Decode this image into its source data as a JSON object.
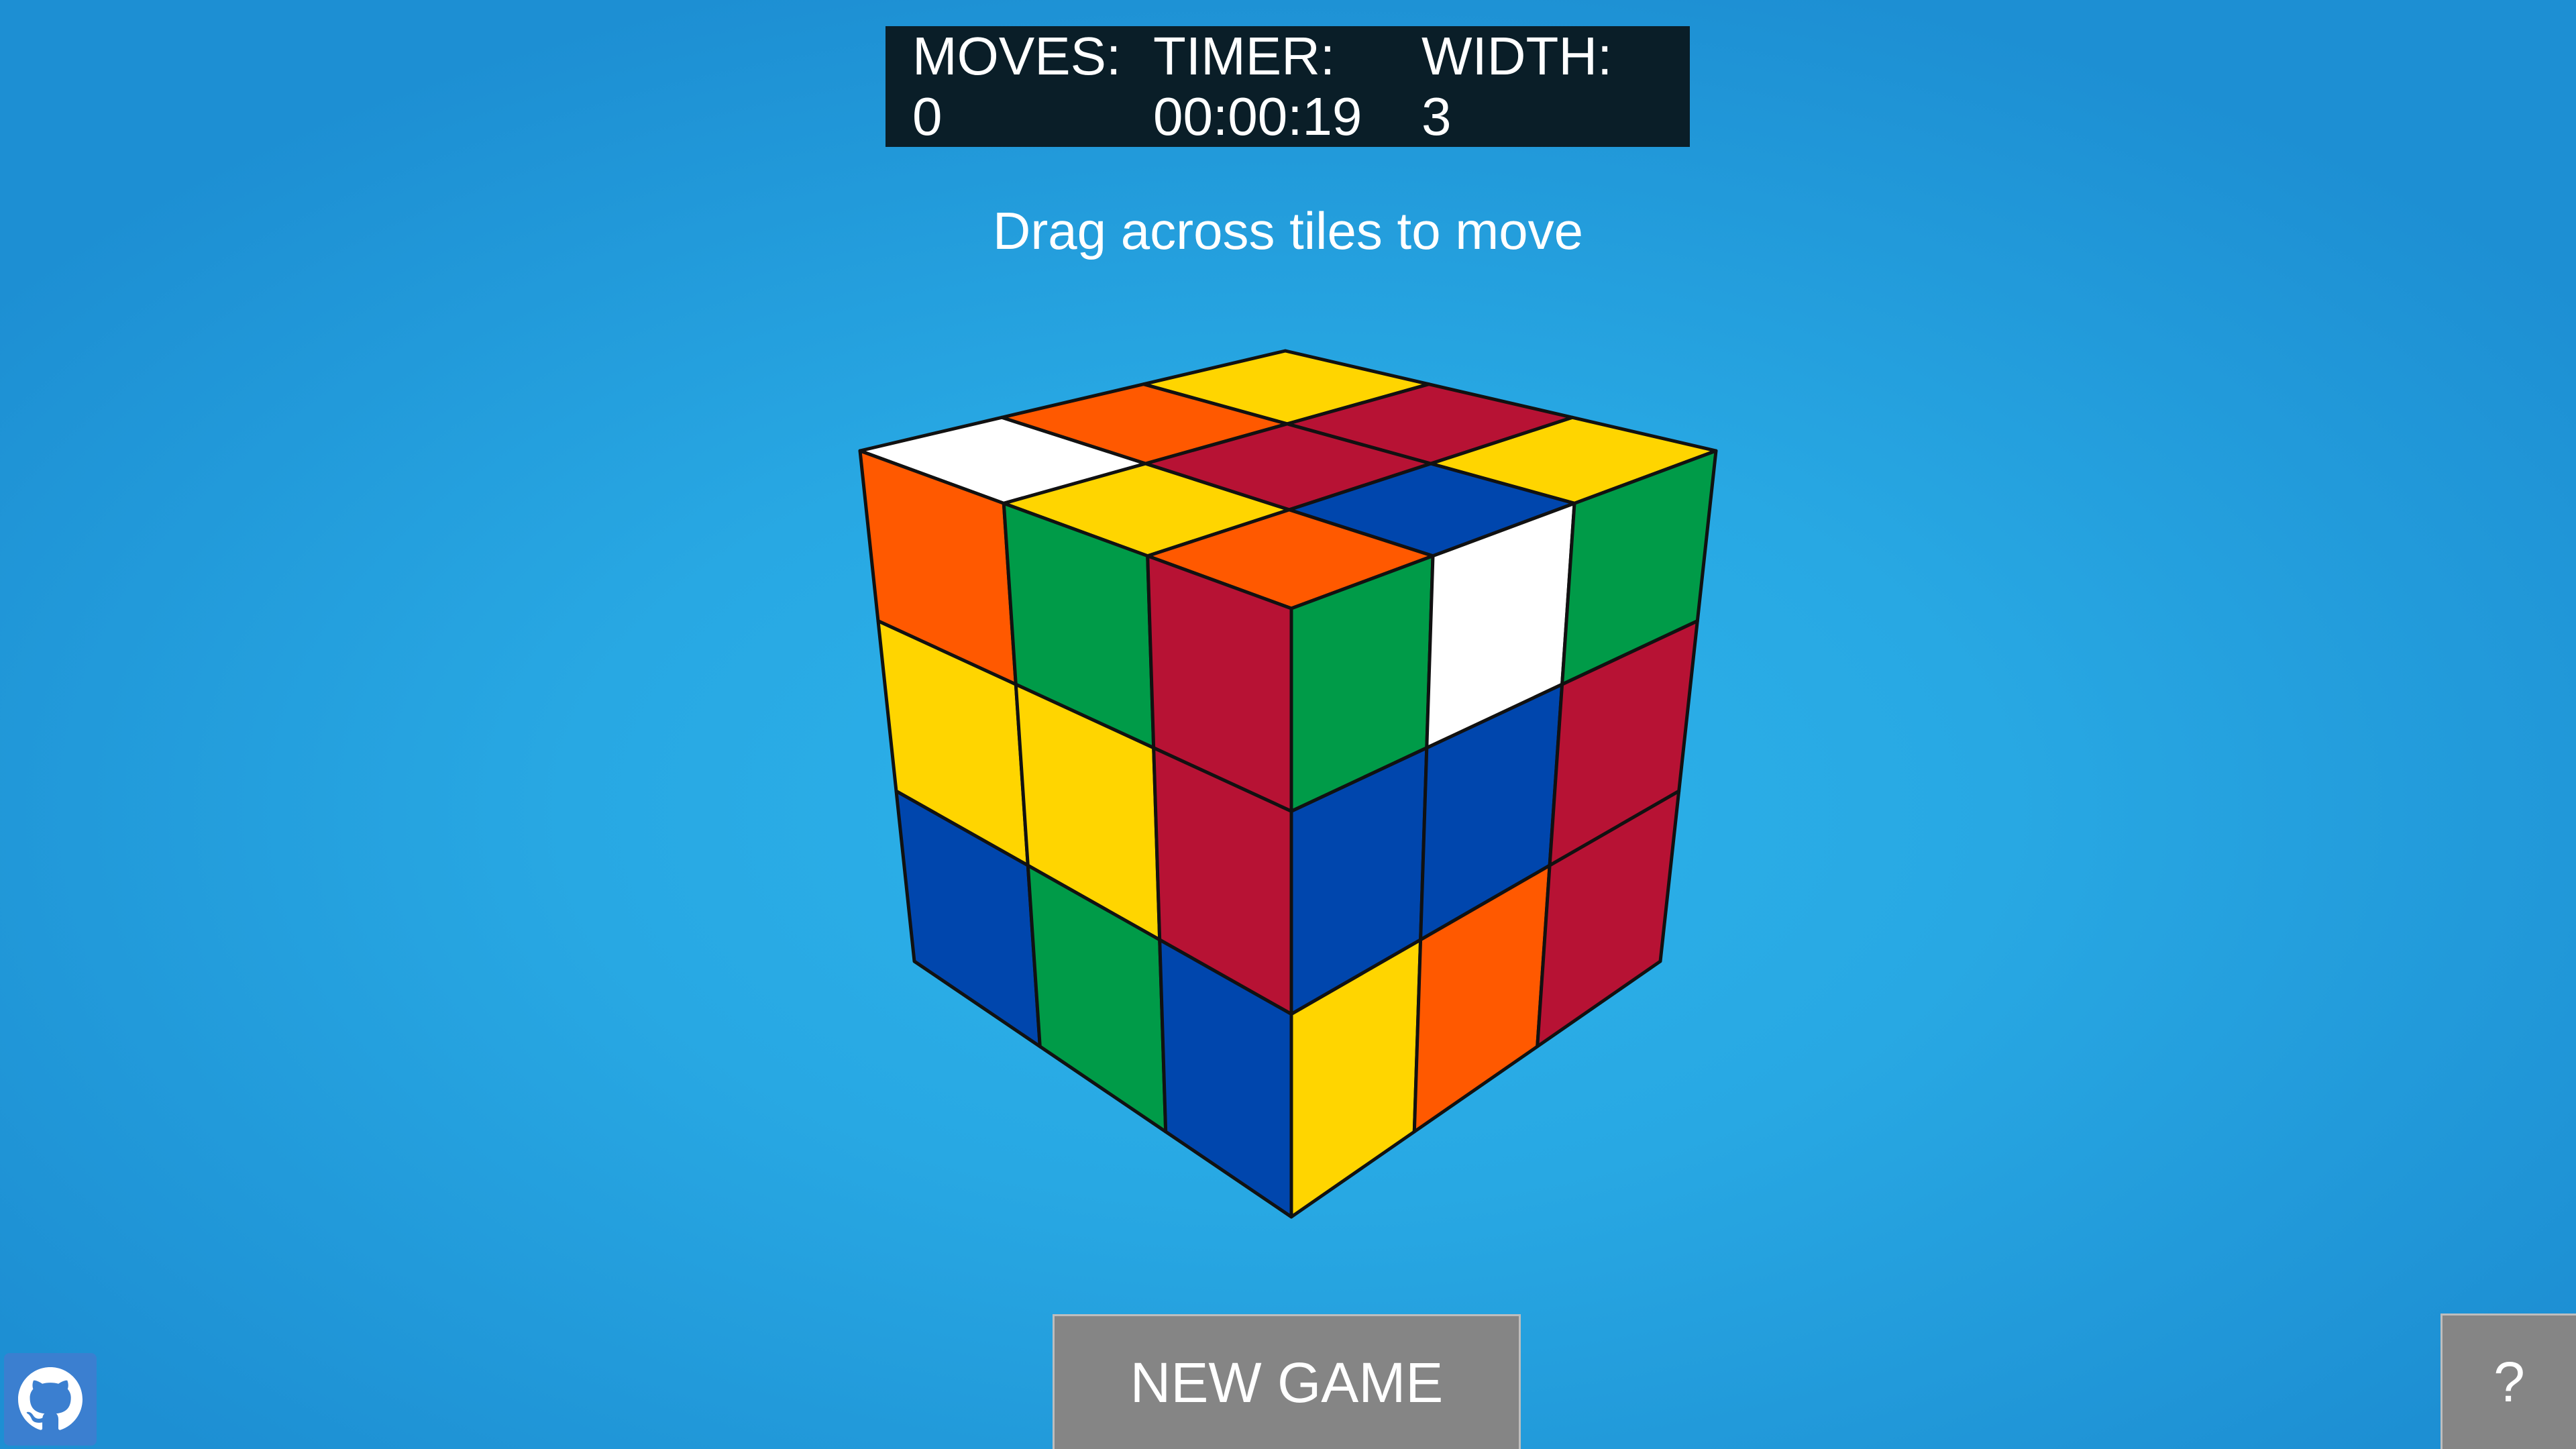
{
  "hud": {
    "moves_label": "MOVES:",
    "moves_value": "0",
    "timer_label": "TIMER:",
    "timer_value": "00:00:19",
    "width_label": "WIDTH:",
    "width_value": "3"
  },
  "hint": "Drag across tiles to move",
  "buttons": {
    "new_game": "NEW GAME",
    "help": "?"
  },
  "icons": {
    "github": "github-icon"
  },
  "colors": {
    "background": "#28a8e3",
    "hud_background": "#0a1e28",
    "button_background": "#858585",
    "github_button": "#3b7fd0"
  },
  "cube": {
    "size": 3,
    "palette": {
      "W": "#ffffff",
      "Y": "#ffd500",
      "O": "#ff5900",
      "R": "#b71234",
      "G": "#009b48",
      "B": "#0046ad"
    },
    "faces": {
      "top": [
        [
          "Y",
          "R",
          "Y"
        ],
        [
          "O",
          "R",
          "B"
        ],
        [
          "W",
          "Y",
          "O"
        ]
      ],
      "left": [
        [
          "O",
          "G",
          "R"
        ],
        [
          "Y",
          "Y",
          "R"
        ],
        [
          "B",
          "G",
          "B"
        ]
      ],
      "right": [
        [
          "G",
          "W",
          "G"
        ],
        [
          "B",
          "B",
          "R"
        ],
        [
          "Y",
          "O",
          "R"
        ]
      ]
    }
  }
}
